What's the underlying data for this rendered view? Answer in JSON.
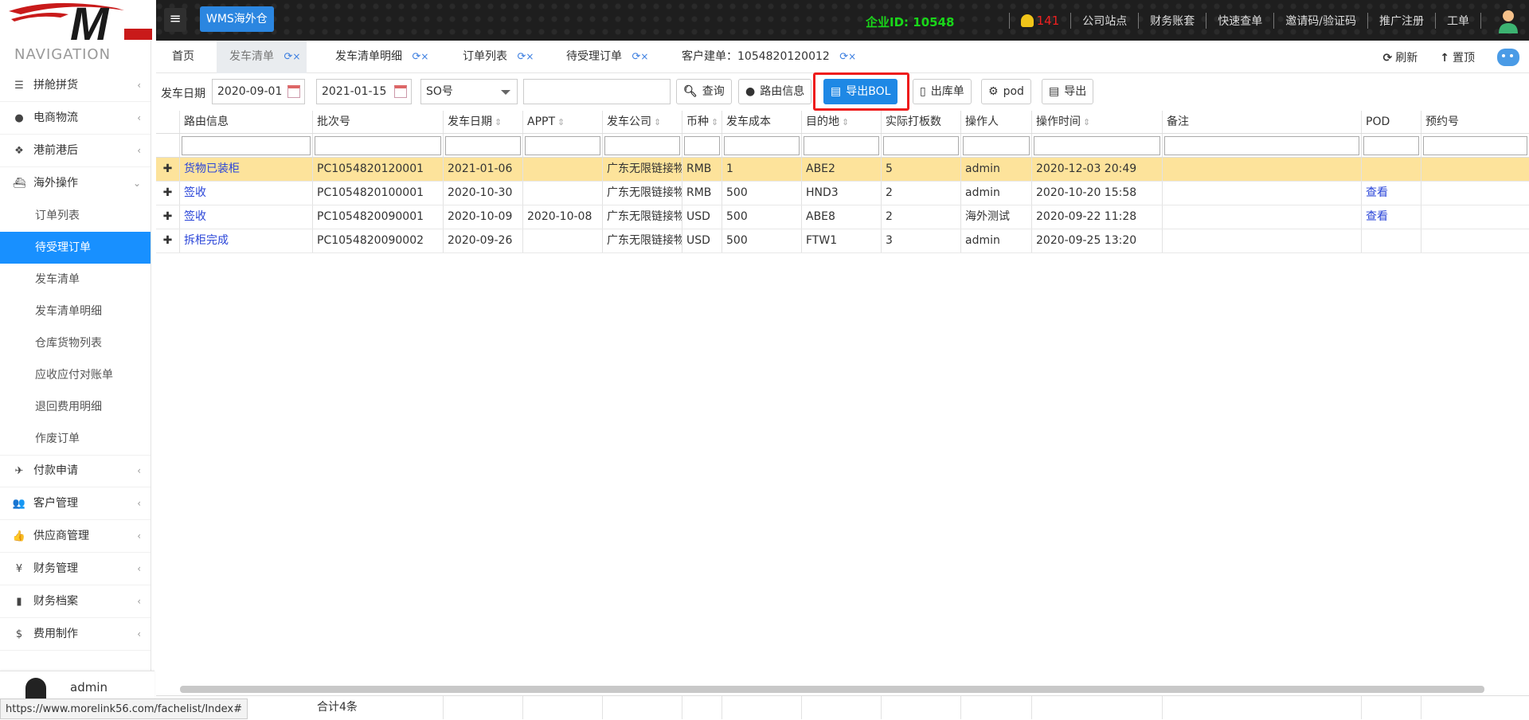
{
  "header": {
    "wms_label": "WMS海外仓",
    "company_id_label": "企业ID:",
    "company_id": "10548",
    "bell_count": "141",
    "links": [
      "公司站点",
      "财务账套",
      "快速查单",
      "邀请码/验证码",
      "推广注册",
      "工单"
    ],
    "colors": {
      "company_id": "#19d619",
      "bell_count": "#f02020",
      "wms_button": "#2b86e0"
    }
  },
  "sidebar": {
    "title": "NAVIGATION",
    "items": [
      {
        "label": "拼舱拼货",
        "icon": "list-icon"
      },
      {
        "label": "电商物流",
        "icon": "globe-icon"
      },
      {
        "label": "港前港后",
        "icon": "cubes-icon"
      },
      {
        "label": "海外操作",
        "icon": "ship-icon",
        "expanded": true
      }
    ],
    "sub_items": [
      "订单列表",
      "待受理订单",
      "发车清单",
      "发车清单明细",
      "仓库货物列表",
      "应收应付对账单",
      "退回费用明细",
      "作废订单"
    ],
    "active_sub": "待受理订单",
    "items_after": [
      {
        "label": "付款申请",
        "icon": "paper-plane-icon"
      },
      {
        "label": "客户管理",
        "icon": "users-icon"
      },
      {
        "label": "供应商管理",
        "icon": "thumbs-up-icon"
      },
      {
        "label": "财务管理",
        "icon": "yen-icon"
      },
      {
        "label": "财务档案",
        "icon": "book-icon"
      },
      {
        "label": "费用制作",
        "icon": "dollar-icon"
      }
    ],
    "user": "admin"
  },
  "tabs": {
    "items": [
      "首页",
      "发车清单",
      "发车清单明细",
      "订单列表",
      "待受理订单",
      "客户建单：1054820120012"
    ],
    "active": "发车清单",
    "refresh_label": "刷新",
    "top_label": "置顶"
  },
  "toolbar": {
    "date_label": "发车日期",
    "date_from": "2020-09-01",
    "date_to": "2021-01-15",
    "select_value": "SO号",
    "search_value": "",
    "buttons": {
      "query": "查询",
      "route": "路由信息",
      "export_bol": "导出BOL",
      "outbound": "出库单",
      "pod": "pod",
      "export": "导出"
    }
  },
  "grid": {
    "columns": [
      "路由信息",
      "批次号",
      "发车日期",
      "APPT",
      "发车公司",
      "币种",
      "发车成本",
      "目的地",
      "实际打板数",
      "操作人",
      "操作时间",
      "备注",
      "POD",
      "预约号"
    ],
    "rows": [
      [
        "货物已装柜",
        "PC1054820120001",
        "2021-01-06",
        "",
        "广东无限链接物流",
        "RMB",
        "1",
        "ABE2",
        "5",
        "admin",
        "2020-12-03 20:49",
        "",
        "",
        ""
      ],
      [
        "签收",
        "PC1054820100001",
        "2020-10-30",
        "",
        "广东无限链接物流",
        "RMB",
        "500",
        "HND3",
        "2",
        "admin",
        "2020-10-20 15:58",
        "",
        "查看",
        ""
      ],
      [
        "签收",
        "PC1054820090001",
        "2020-10-09",
        "2020-10-08",
        "广东无限链接物流",
        "USD",
        "500",
        "ABE8",
        "2",
        "海外测试",
        "2020-09-22 11:28",
        "",
        "查看",
        ""
      ],
      [
        "拆柜完成",
        "PC1054820090002",
        "2020-09-26",
        "",
        "广东无限链接物流",
        "USD",
        "500",
        "FTW1",
        "3",
        "admin",
        "2020-09-25 13:20",
        "",
        "",
        ""
      ]
    ],
    "selected_row": 0
  },
  "footer": {
    "total": "合计4条",
    "status_url": "https://www.morelink56.com/fachelist/Index#"
  }
}
